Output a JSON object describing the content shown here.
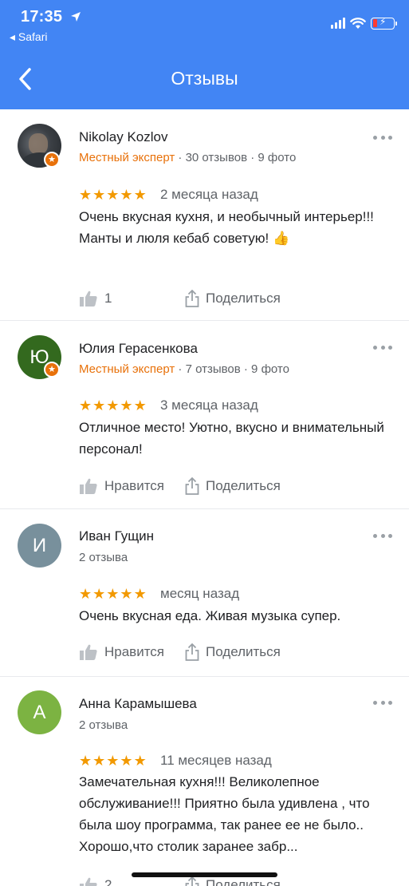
{
  "status": {
    "time": "17:35",
    "back_app": "◂ Safari"
  },
  "header": {
    "title": "Отзывы"
  },
  "common": {
    "share_label": "Поделиться",
    "like_label": "Нравится"
  },
  "reviews": [
    {
      "name": "Nikolay Kozlov",
      "expert_label": "Местный эксперт",
      "stats": " · 30 отзывов · 9 фото",
      "rating": 5,
      "time_ago": "2 месяца назад",
      "text": "Очень вкусная кухня, и необычный интерьер!!! Манты и люля кебаб советую! 👍",
      "likes": "1"
    },
    {
      "name": "Юлия Герасенкова",
      "avatar_letter": "Ю",
      "avatar_color": "#33691e",
      "expert_label": "Местный эксперт",
      "stats": " · 7 отзывов · 9 фото",
      "rating": 5,
      "time_ago": "3 месяца назад",
      "text": "Отличное место! Уютно, вкусно и внимательный персонал!"
    },
    {
      "name": "Иван Гущин",
      "avatar_letter": "И",
      "avatar_color": "#78909c",
      "stats": "2 отзыва",
      "rating": 5,
      "time_ago": "месяц назад",
      "text": "Очень вкусная еда. Живая музыка супер."
    },
    {
      "name": "Анна Карамышева",
      "avatar_letter": "А",
      "avatar_color": "#7cb342",
      "stats": "2 отзыва",
      "rating": 5,
      "time_ago": "11 месяцев назад",
      "text": "Замечательная кухня!!! Великолепное обслуживание!!! Приятно была удивлена , что была шоу программа, так ранее ее не было.. Хорошо,что столик заранее забр...",
      "likes": "2"
    }
  ],
  "colors": {
    "header_bg": "#4285f4",
    "expert": "#e8710a",
    "stars": "#f29900"
  }
}
